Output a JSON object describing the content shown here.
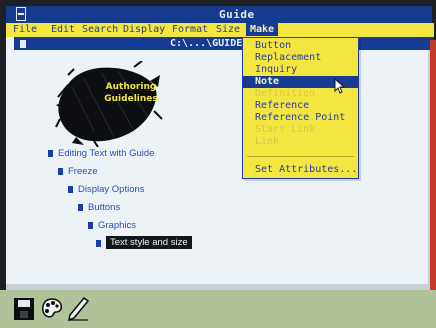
{
  "window": {
    "title": "Guide"
  },
  "menu": {
    "items": [
      "File",
      "Edit",
      "Search",
      "Display",
      "Format",
      "Size",
      "Make"
    ],
    "active": "Make"
  },
  "document": {
    "caption": "C:\\...\\GUIDE\\AU"
  },
  "graphic": {
    "line1": "Authoring",
    "line2": "Guidelines"
  },
  "outline": [
    {
      "label": "Editing Text with Guide"
    },
    {
      "label": "Freeze"
    },
    {
      "label": "Display Options"
    },
    {
      "label": "Buttons"
    },
    {
      "label": "Graphics"
    },
    {
      "label": "Text style and size",
      "highlighted": true
    }
  ],
  "make_menu": {
    "items": [
      {
        "label": "Button",
        "state": "enabled"
      },
      {
        "label": "Replacement",
        "state": "enabled"
      },
      {
        "label": "Inquiry",
        "state": "enabled"
      },
      {
        "label": "Note",
        "state": "selected"
      },
      {
        "label": "Definition",
        "state": "disabled"
      },
      {
        "label": "Reference",
        "state": "enabled"
      },
      {
        "label": "Reference Point",
        "state": "enabled"
      },
      {
        "label": "Start Link",
        "state": "disabled"
      },
      {
        "label": "Link",
        "state": "disabled"
      },
      {
        "label": "Set Attributes...",
        "state": "enabled"
      }
    ]
  },
  "taskbar": {
    "icons": [
      "disk-icon",
      "palette-icon",
      "pen-icon"
    ]
  },
  "colors": {
    "titlebar": "#163a8e",
    "menubar": "#f4e640",
    "document": "#ecf2f6",
    "outline_text": "#2a4fb6",
    "taskbar": "#b1c19a"
  }
}
